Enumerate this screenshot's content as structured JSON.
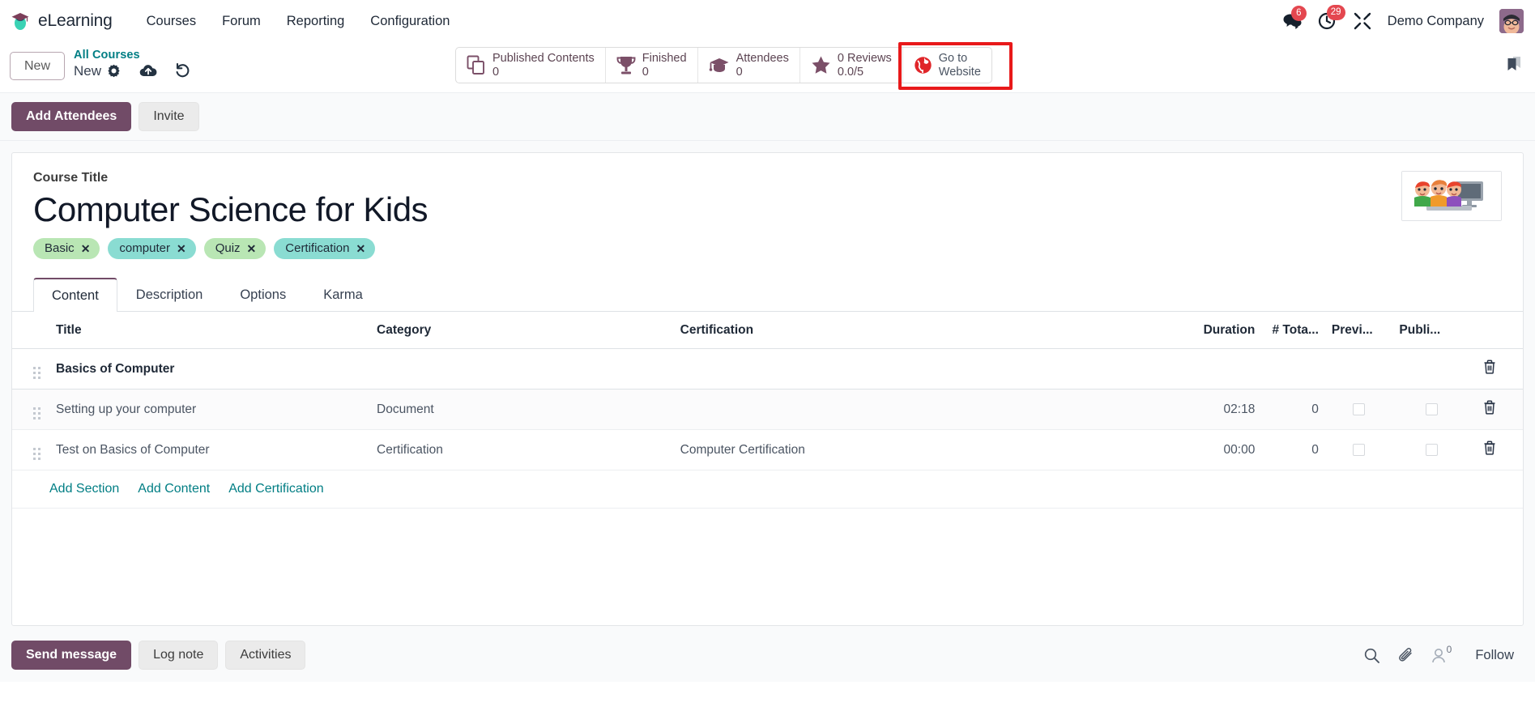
{
  "navbar": {
    "brand": "eLearning",
    "brand_logo_icon": "graduation-cap-logo",
    "links": [
      {
        "label": "Courses"
      },
      {
        "label": "Forum"
      },
      {
        "label": "Reporting"
      },
      {
        "label": "Configuration"
      }
    ],
    "messages_icon": "chat-bubbles-icon",
    "messages_count": "6",
    "activities_icon": "clock-icon",
    "activities_count": "29",
    "debug_icon": "tools-icon",
    "company": "Demo Company",
    "avatar_icon": "user-avatar"
  },
  "control_panel": {
    "new_button": "New",
    "breadcrumb_parent": "All Courses",
    "breadcrumb_current": "New",
    "gear_icon": "gear-icon",
    "upload_icon": "cloud-upload-icon",
    "discard_icon": "undo-icon",
    "bookmark_icon": "bookmark-icon",
    "stat_buttons": [
      {
        "icon": "documents-icon",
        "label": "Published Contents",
        "value": "0",
        "name": "published-contents"
      },
      {
        "icon": "trophy-icon",
        "label": "Finished",
        "value": "0",
        "name": "finished"
      },
      {
        "icon": "graduation-cap-icon",
        "label": "Attendees",
        "value": "0",
        "name": "attendees"
      },
      {
        "icon": "star-icon",
        "label": "0 Reviews",
        "value": "0.0/5",
        "name": "reviews"
      }
    ],
    "website_button": {
      "icon": "globe-icon",
      "label_line1": "Go to",
      "label_line2": "Website",
      "highlighted": true
    },
    "highlight_color": "#e8191a"
  },
  "action_bar": {
    "primary_button": "Add Attendees",
    "secondary_button": "Invite"
  },
  "form": {
    "course_title_label": "Course Title",
    "course_title": "Computer Science for Kids",
    "course_image_icon": "kids-at-computer-image",
    "tags": [
      {
        "label": "Basic",
        "color": "#b9e6b4"
      },
      {
        "label": "computer",
        "color": "#8adcd2"
      },
      {
        "label": "Quiz",
        "color": "#b9e6b4"
      },
      {
        "label": "Certification",
        "color": "#8adcd2"
      }
    ],
    "tabs": [
      {
        "label": "Content",
        "active": true
      },
      {
        "label": "Description",
        "active": false
      },
      {
        "label": "Options",
        "active": false
      },
      {
        "label": "Karma",
        "active": false
      }
    ]
  },
  "content_table": {
    "columns": [
      "Title",
      "Category",
      "Certification",
      "Duration",
      "# Tota...",
      "Previ...",
      "Publi..."
    ],
    "rows": [
      {
        "type": "section",
        "title": "Basics of Computer",
        "category": "",
        "certification": "",
        "duration": "",
        "total": "",
        "preview": null,
        "published": null,
        "delete_icon": "trash-icon"
      },
      {
        "type": "content",
        "title": "Setting up your computer",
        "category": "Document",
        "certification": "",
        "duration": "02:18",
        "total": "0",
        "preview": false,
        "published": false,
        "delete_icon": "trash-icon"
      },
      {
        "type": "content",
        "title": "Test on Basics of Computer",
        "category": "Certification",
        "certification": "Computer Certification",
        "duration": "00:00",
        "total": "0",
        "preview": false,
        "published": false,
        "delete_icon": "trash-icon"
      }
    ],
    "add_links": [
      "Add Section",
      "Add Content",
      "Add Certification"
    ]
  },
  "chatter": {
    "send_message": "Send message",
    "log_note": "Log note",
    "activities": "Activities",
    "search_icon": "search-icon",
    "attachment_icon": "paperclip-icon",
    "followers_icon": "person-icon",
    "followers_count": "0",
    "follow_button": "Follow"
  }
}
